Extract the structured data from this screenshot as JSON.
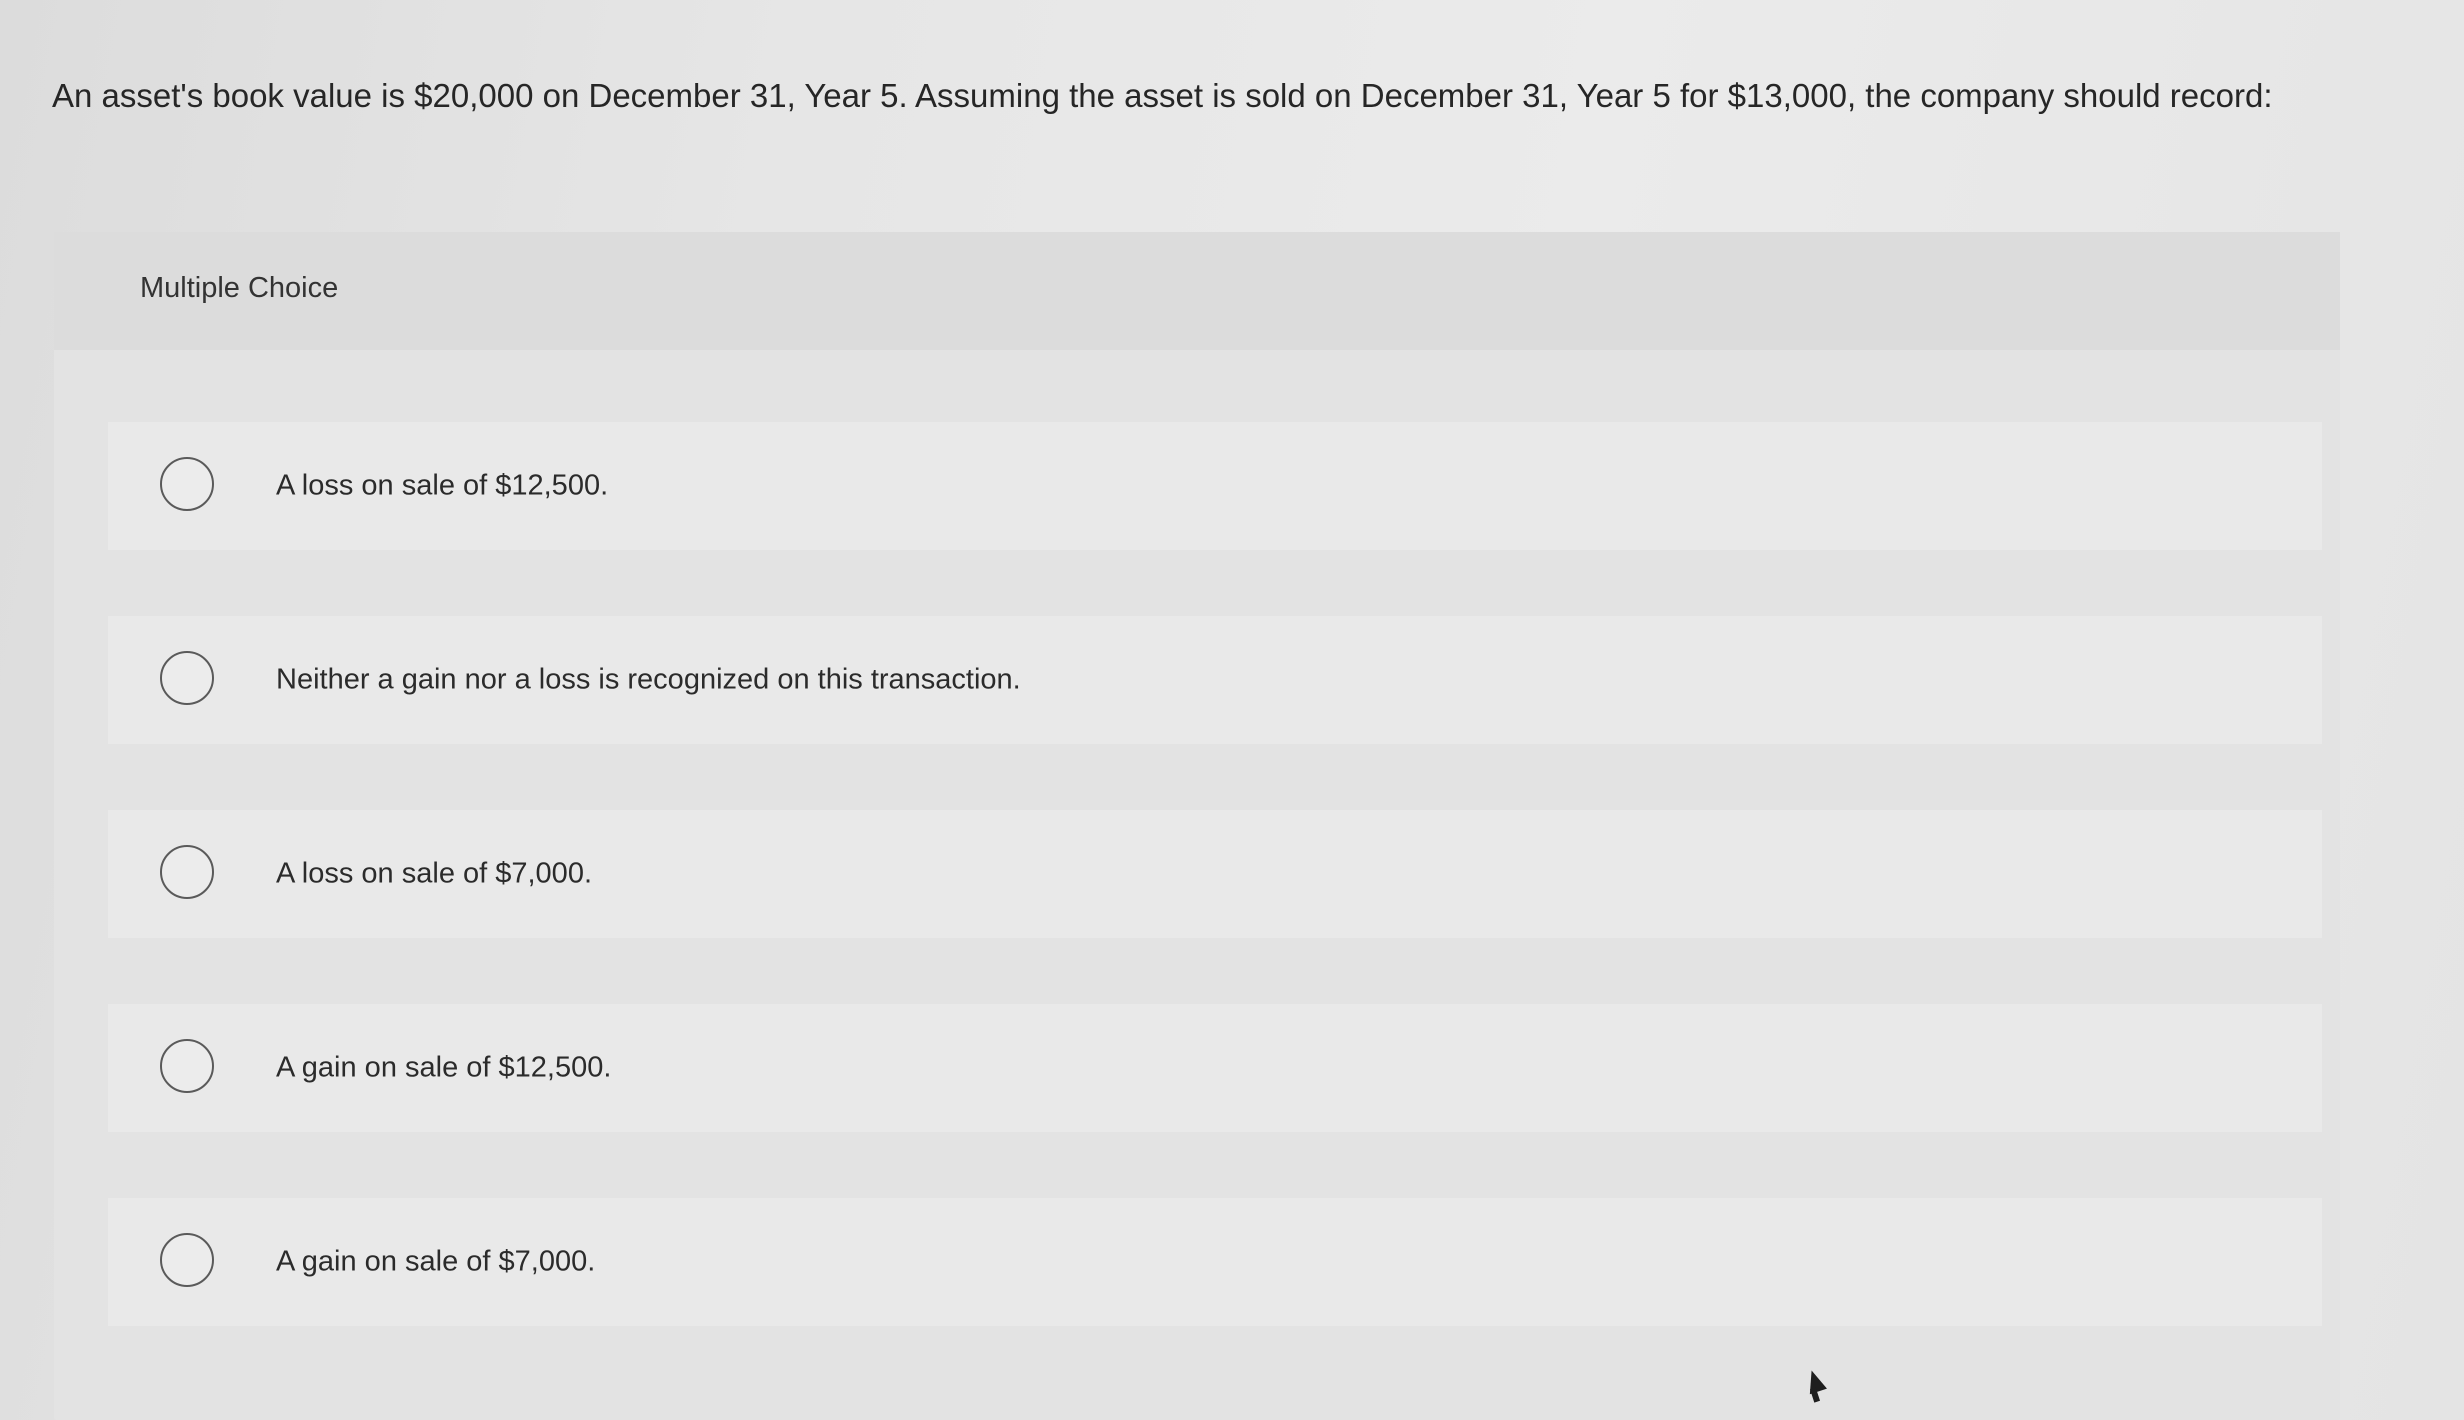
{
  "question": {
    "text": "An asset's book value is $20,000 on December 31, Year 5. Assuming the asset is sold on December 31, Year 5 for $13,000, the company should record:"
  },
  "multiple_choice": {
    "title": "Multiple Choice",
    "options": [
      {
        "label": "A loss on sale of $12,500.",
        "selected": false
      },
      {
        "label": "Neither a gain nor a loss is recognized on this transaction.",
        "selected": false
      },
      {
        "label": "A loss on sale of $7,000.",
        "selected": false
      },
      {
        "label": "A gain on sale of $12,500.",
        "selected": false
      },
      {
        "label": "A gain on sale of $7,000.",
        "selected": false
      }
    ]
  },
  "icons": {
    "radio": "radio-unchecked-icon",
    "cursor": "mouse-pointer-icon"
  }
}
